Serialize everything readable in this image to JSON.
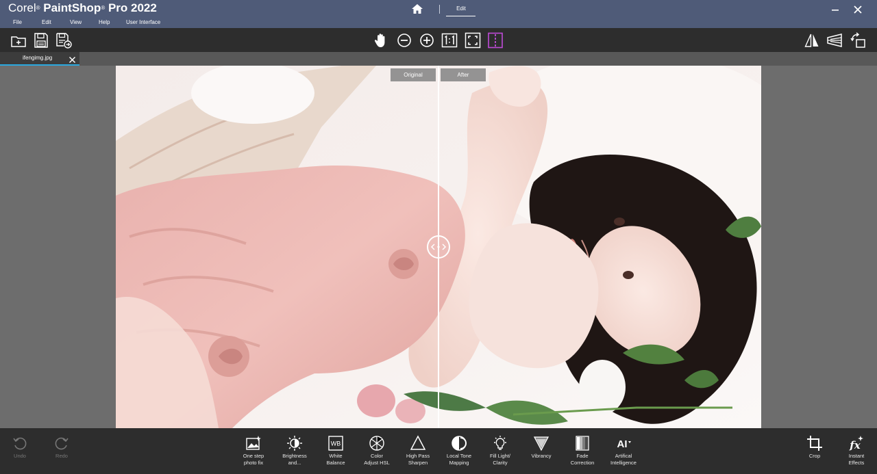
{
  "app": {
    "brand_corel": "Corel",
    "brand_reg": "®",
    "brand_product": " PaintShop",
    "brand_reg2": "®",
    "brand_version": "Pro 2022",
    "menu": [
      "File",
      "Edit",
      "View",
      "Help",
      "User Interface"
    ],
    "mode_tab": "Edit"
  },
  "toolbar": {
    "left": [
      "new-image-icon",
      "save-icon",
      "save-as-icon"
    ],
    "center": [
      "pan-hand-icon",
      "zoom-out-icon",
      "zoom-in-icon",
      "actual-size-icon",
      "fit-to-window-icon",
      "split-compare-icon"
    ],
    "right": [
      "flip-horizontal-icon",
      "perspective-icon",
      "rotate-icon"
    ],
    "active_color": "#c04bd8"
  },
  "document": {
    "tab_name": "ifengimg.jpg",
    "tab_accent": "#2aa9e0"
  },
  "compare": {
    "original_label": "Original",
    "after_label": "After"
  },
  "bottom": {
    "undo": "Undo",
    "redo": "Redo",
    "adjust": [
      {
        "label": "One step\nphoto fix",
        "icon": "one-step-photo-fix-icon"
      },
      {
        "label": "Brightness\nand...",
        "icon": "brightness-icon"
      },
      {
        "label": "White\nBalance",
        "icon": "white-balance-icon"
      },
      {
        "label": "Color\nAdjust HSL",
        "icon": "color-adjust-icon"
      },
      {
        "label": "High Pass\nSharpen",
        "icon": "high-pass-sharpen-icon"
      },
      {
        "label": "Local Tone\nMapping",
        "icon": "local-tone-mapping-icon"
      },
      {
        "label": "Fill Light/\nClarity",
        "icon": "fill-light-icon"
      },
      {
        "label": "Vibrancy",
        "icon": "vibrancy-icon"
      },
      {
        "label": "Fade\nCorrection",
        "icon": "fade-correction-icon"
      },
      {
        "label": "Artifical\nIntelligence",
        "icon": "ai-icon"
      }
    ],
    "wb_text": "WB",
    "ai_text": "AI",
    "fx_text": "fx",
    "crop": "Crop",
    "instant_effects": "Instant\nEffects"
  }
}
